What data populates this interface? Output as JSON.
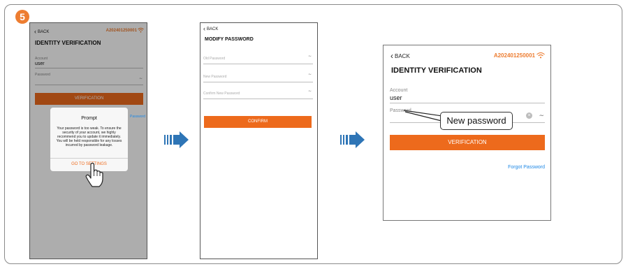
{
  "step": {
    "number": "5"
  },
  "colors": {
    "accent": "#ed6a1c",
    "link": "#1e88e5",
    "arrow": "#2e75b6"
  },
  "screen1": {
    "back_label": "BACK",
    "serial": "A202401250001",
    "title": "IDENTITY VERIFICATION",
    "account_label": "Account",
    "account_value": "user",
    "password_label": "Password",
    "verify_button": "VERIFICATION",
    "forgot_link": "Password",
    "dialog": {
      "title": "Prompt",
      "message": "Your password is too weak. To ensure the security of your account, we highly recommend you to update it immediately. You will be held responsible for any losses incurred by password leakage.",
      "button": "GO TO SETTINGS"
    },
    "icons": {
      "wifi": "wifi-icon",
      "eye": "eye-closed-icon",
      "hand": "pointing-hand-icon"
    }
  },
  "screen2": {
    "back_label": "BACK",
    "title": "MODIFY PASSWORD",
    "old_password_placeholder": "Old Password",
    "new_password_placeholder": "New Password",
    "confirm_password_placeholder": "Confirm New Password",
    "confirm_button": "CONFIRM"
  },
  "screen3": {
    "back_label": "BACK",
    "serial": "A202401250001",
    "title": "IDENTITY VERIFICATION",
    "account_label": "Account",
    "account_value": "user",
    "password_label": "Password",
    "verify_button": "VERIFICATION",
    "forgot_link": "Forgot Password",
    "callout": "New password"
  }
}
